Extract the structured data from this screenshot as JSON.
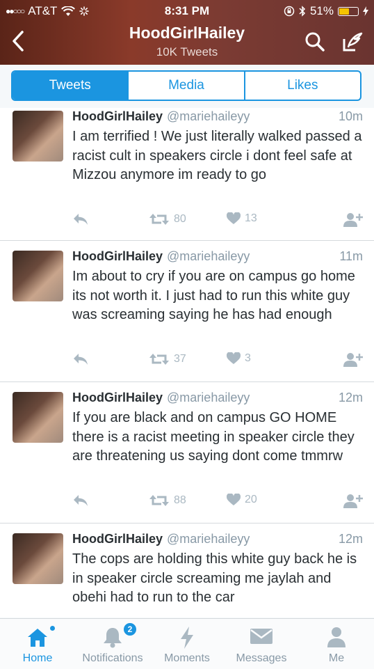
{
  "status_bar": {
    "signal": "●●○○○",
    "carrier": "AT&T",
    "time": "8:31 PM",
    "battery": "51%",
    "battery_level": 0.51
  },
  "header": {
    "title": "HoodGirlHailey",
    "subtitle": "10K Tweets"
  },
  "tabs": [
    {
      "label": "Tweets",
      "active": true
    },
    {
      "label": "Media",
      "active": false
    },
    {
      "label": "Likes",
      "active": false
    }
  ],
  "tweets": [
    {
      "name": "HoodGirlHailey",
      "handle": "@mariehaileyy",
      "time": "10m",
      "text": "I am terrified ! We just literally walked passed a racist cult in speakers circle i dont feel safe at Mizzou anymore im ready to go",
      "retweets": "80",
      "likes": "13"
    },
    {
      "name": "HoodGirlHailey",
      "handle": "@mariehaileyy",
      "time": "11m",
      "text": "Im about to cry if you are on campus go home its not worth it. I just had to run this white guy was screaming saying he has had enough",
      "retweets": "37",
      "likes": "3"
    },
    {
      "name": "HoodGirlHailey",
      "handle": "@mariehaileyy",
      "time": "12m",
      "text": "If you are black and on campus GO HOME there is a racist meeting in speaker circle they are threatening us saying dont come tmmrw",
      "retweets": "88",
      "likes": "20"
    },
    {
      "name": "HoodGirlHailey",
      "handle": "@mariehaileyy",
      "time": "12m",
      "text": "The cops are holding this white guy back he is in speaker circle screaming me jaylah and obehi had to run to the car",
      "retweets": "",
      "likes": ""
    }
  ],
  "bottom_nav": [
    {
      "label": "Home",
      "icon": "home-icon",
      "active": true
    },
    {
      "label": "Notifications",
      "icon": "bell-icon",
      "badge": "2"
    },
    {
      "label": "Moments",
      "icon": "lightning-icon"
    },
    {
      "label": "Messages",
      "icon": "envelope-icon"
    },
    {
      "label": "Me",
      "icon": "person-icon"
    }
  ],
  "colors": {
    "accent": "#1b95e0",
    "header_bg": "#7b3b33",
    "muted": "#8899a6"
  }
}
